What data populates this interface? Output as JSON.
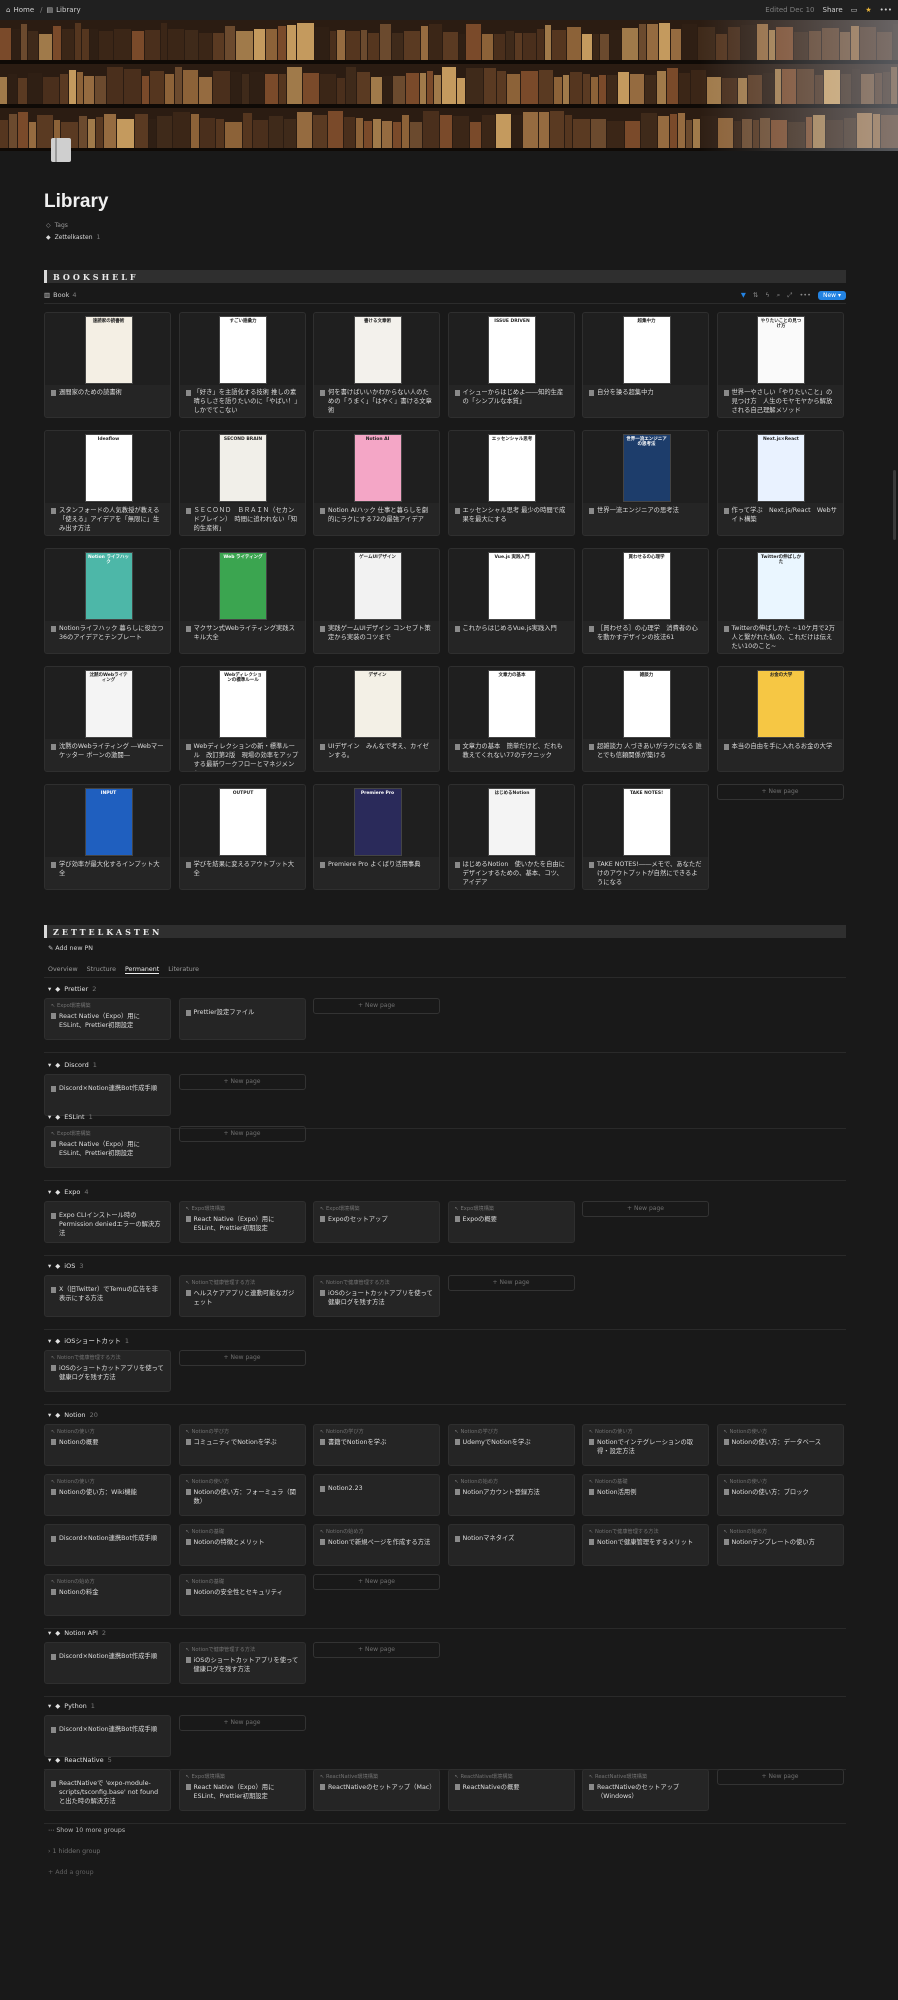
{
  "topbar": {
    "home": "Home",
    "sep": "/",
    "library": "Library",
    "edited": "Edited Dec 10",
    "share": "Share"
  },
  "page": {
    "title": "Library",
    "prop_tags": "Tags",
    "prop_zk": "Zettelkasten",
    "prop_zk_count": "1"
  },
  "bookshelf": {
    "heading": "BOOKSHELF",
    "view": "Book",
    "view_count": "4",
    "new_label": "New"
  },
  "books": [
    {
      "title": "週間家のための読書術",
      "cover": "速読家の読書術",
      "color": "#f4efe4"
    },
    {
      "title": "「好き」を主語化する技術 推しの素晴らしさを語りたいのに「やばい！」しかでてこない",
      "cover": "すごい語彙力",
      "color": "#ffffff"
    },
    {
      "title": "何を書けばいいかわからない人のための「うまく」「はやく」書ける文章術",
      "cover": "書ける文章術",
      "color": "#f3f1ec"
    },
    {
      "title": "イシューからはじめよ――知的生産の「シンプルな本質」",
      "cover": "ISSUE DRIVEN",
      "color": "#ffffff"
    },
    {
      "title": "自分を操る超集中力",
      "cover": "超集中力",
      "color": "#ffffff"
    },
    {
      "title": "世界一やさしい「やりたいこと」の見つけ方　人生のモヤモヤから解放される自己理解メソッド",
      "cover": "やりたいことの見つけ方",
      "color": "#fafafa"
    },
    {
      "title": "スタンフォードの人気教授が教える「使える」アイデアを「無限に」生み出す方法",
      "cover": "Ideaflow",
      "color": "#ffffff"
    },
    {
      "title": "ＳＥＣＯＮＤ　ＢＲＡＩＮ（セカンドブレイン）　時間に追われない「知的生産術」",
      "cover": "SECOND BRAIN",
      "color": "#f1efe9"
    },
    {
      "title": "Notion AIハック 仕事と暮らしを劇的にラクにする72の最強アイデア",
      "cover": "Notion AI",
      "color": "#f4a6c6"
    },
    {
      "title": "エッセンシャル思考 最少の時間で成果を最大にする",
      "cover": "エッセンシャル思考",
      "color": "#ffffff"
    },
    {
      "title": "世界一流エンジニアの思考法",
      "cover": "世界一流エンジニアの思考法",
      "color": "#1d3d6b"
    },
    {
      "title": "作って学ぶ　Next.js/React　Webサイト構築",
      "cover": "Next.js×React",
      "color": "#e9f2ff"
    },
    {
      "title": "Notionライフハック 暮らしに役立つ36のアイデアとテンプレート",
      "cover": "Notion ライフハック",
      "color": "#4db7a8"
    },
    {
      "title": "マクサン式Webライティング実践スキル大全",
      "cover": "Web ライティング",
      "color": "#3ba550"
    },
    {
      "title": "実践ゲームUIデザイン コンセプト策定から実装のコツまで",
      "cover": "ゲームUIデザイン",
      "color": "#f2f2f2"
    },
    {
      "title": "これからはじめるVue.js実践入門",
      "cover": "Vue.js 実践入門",
      "color": "#ffffff"
    },
    {
      "title": "［買わせる］の心理学　消費者の心を動かすデザインの技法61",
      "cover": "買わせるの心理学",
      "color": "#ffffff"
    },
    {
      "title": "Twitterの伸ばしかた ~10ケ月で2万人と繋がれた私の、これだけは伝えたい10のこと~",
      "cover": "Twitterの伸ばしかた",
      "color": "#eaf6ff"
    },
    {
      "title": "沈黙のWebライティング ―Webマーケッター ボーンの激闘―",
      "cover": "沈黙のWebライティング",
      "color": "#f4f4f4"
    },
    {
      "title": "Webディレクションの新・標準ルール　改訂第2版　現場の効率をアップする最新ワークフローとマネジメント",
      "cover": "Webディレクションの標準ルール",
      "color": "#ffffff"
    },
    {
      "title": "UIデザイン　みんなで考え、カイゼンする。",
      "cover": "デザイン",
      "color": "#f3f0e6"
    },
    {
      "title": "文章力の基本　簡単だけど、だれも教えてくれない77のテクニック",
      "cover": "文章力の基本",
      "color": "#ffffff"
    },
    {
      "title": "超雑談力 人づきあいがラクになる 誰とでも信頼関係が築ける",
      "cover": "雑談力",
      "color": "#ffffff"
    },
    {
      "title": "本当の自由を手に入れるお金の大学",
      "cover": "お金の大学",
      "color": "#f6c744"
    },
    {
      "title": "学び効率が最大化するインプット大全",
      "cover": "INPUT",
      "color": "#1f5fbf"
    },
    {
      "title": "学びを結果に変えるアウトプット大全",
      "cover": "OUTPUT",
      "color": "#ffffff"
    },
    {
      "title": "Premiere Pro よくばり活用事典",
      "cover": "Premiere Pro",
      "color": "#2a2a5a"
    },
    {
      "title": "はじめるNotion　使いかたを自由にデザインするための、基本、コツ、アイデア",
      "cover": "はじめるNotion",
      "color": "#f4f4f4"
    },
    {
      "title": "TAKE NOTES!――メモで、あなただけのアウトプットが自然にできるようになる",
      "cover": "TAKE NOTES!",
      "color": "#ffffff"
    }
  ],
  "bookshelf_new": "+ New page",
  "zettelkasten": {
    "heading": "ZETTELKASTEN",
    "add": "Add new PN",
    "tabs": [
      "Overview",
      "Structure",
      "Permanent",
      "Literature"
    ],
    "active_tab": "Permanent",
    "new_page": "+ New page",
    "groups": [
      {
        "name": "Prettier",
        "count": "2",
        "cards": [
          {
            "rel": "Expo環境構築",
            "title": "React Native（Expo）用にESLint、Prettier初期設定"
          },
          {
            "rel": "",
            "title": "Prettier設定ファイル"
          }
        ]
      },
      {
        "name": "Discord",
        "count": "1",
        "cards": [
          {
            "rel": "",
            "title": "Discord×Notion連携Bot作成手順"
          }
        ]
      },
      {
        "name": "ESLint",
        "count": "1",
        "cards": [
          {
            "rel": "Expo環境構築",
            "title": "React Native（Expo）用にESLint、Prettier初期設定"
          }
        ]
      },
      {
        "name": "Expo",
        "count": "4",
        "cards": [
          {
            "rel": "",
            "title": "Expo CLIインストール時のPermission deniedエラーの解決方法"
          },
          {
            "rel": "Expo環境構築",
            "title": "React Native（Expo）用にESLint、Prettier初期設定"
          },
          {
            "rel": "Expo環境構築",
            "title": "Expoのセットアップ"
          },
          {
            "rel": "Expo環境構築",
            "title": "Expoの概要"
          }
        ]
      },
      {
        "name": "iOS",
        "count": "3",
        "cards": [
          {
            "rel": "",
            "title": "X（旧Twitter）でTemuの広告を非表示にする方法"
          },
          {
            "rel": "Notionで健康管理する方法",
            "title": "ヘルスケアアプリと連動可能なガジェット"
          },
          {
            "rel": "Notionで健康管理する方法",
            "title": "iOSのショートカットアプリを使って健康ログを残す方法"
          }
        ]
      },
      {
        "name": "iOSショートカット",
        "count": "1",
        "cards": [
          {
            "rel": "Notionで健康管理する方法",
            "title": "iOSのショートカットアプリを使って健康ログを残す方法"
          }
        ]
      },
      {
        "name": "Notion",
        "count": "20",
        "cards": [
          {
            "rel": "Notionの使い方",
            "title": "Notionの概要"
          },
          {
            "rel": "Notionの学び方",
            "title": "コミュニティでNotionを学ぶ"
          },
          {
            "rel": "Notionの学び方",
            "title": "書籍でNotionを学ぶ"
          },
          {
            "rel": "Notionの学び方",
            "title": "UdemyでNotionを学ぶ"
          },
          {
            "rel": "Notionの使い方",
            "title": "Notionでインテグレーションの取得・設定方法"
          },
          {
            "rel": "Notionの使い方",
            "title": "Notionの使い方：データベース"
          },
          {
            "rel": "Notionの使い方",
            "title": "Notionの使い方：Wiki機能"
          },
          {
            "rel": "Notionの使い方",
            "title": "Notionの使い方：フォーミュラ（関数）"
          },
          {
            "rel": "",
            "title": "Notion2.23"
          },
          {
            "rel": "Notionの始め方",
            "title": "Notionアカウント登録方法"
          },
          {
            "rel": "Notionの基礎",
            "title": "Notion活用例"
          },
          {
            "rel": "Notionの使い方",
            "title": "Notionの使い方：ブロック"
          },
          {
            "rel": "",
            "title": "Discord×Notion連携Bot作成手順"
          },
          {
            "rel": "Notionの基礎",
            "title": "Notionの特徴とメリット"
          },
          {
            "rel": "Notionの始め方",
            "title": "Notionで新規ページを作成する方法"
          },
          {
            "rel": "",
            "title": "Notionマネタイズ"
          },
          {
            "rel": "Notionで健康管理する方法",
            "title": "Notionで健康管理をするメリット"
          },
          {
            "rel": "Notionの始め方",
            "title": "Notionテンプレートの使い方"
          },
          {
            "rel": "Notionの始め方",
            "title": "Notionの料金"
          },
          {
            "rel": "Notionの基礎",
            "title": "Notionの安全性とセキュリティ"
          }
        ]
      },
      {
        "name": "Notion API",
        "count": "2",
        "cards": [
          {
            "rel": "",
            "title": "Discord×Notion連携Bot作成手順"
          },
          {
            "rel": "Notionで健康管理する方法",
            "title": "iOSのショートカットアプリを使って健康ログを残す方法"
          }
        ]
      },
      {
        "name": "Python",
        "count": "1",
        "cards": [
          {
            "rel": "",
            "title": "Discord×Notion連携Bot作成手順"
          }
        ]
      },
      {
        "name": "ReactNative",
        "count": "5",
        "cards": [
          {
            "rel": "",
            "title": "ReactNativeで 'expo-module-scripts/tsconfig.base' not found と出た時の解決方法"
          },
          {
            "rel": "Expo環境構築",
            "title": "React Native（Expo）用にESLint、Prettier初期設定"
          },
          {
            "rel": "ReactNative環境構築",
            "title": "ReactNativeのセットアップ（Mac）"
          },
          {
            "rel": "ReactNative環境構築",
            "title": "ReactNativeの概要"
          },
          {
            "rel": "ReactNative環境構築",
            "title": "ReactNativeのセットアップ（Windows）"
          }
        ]
      }
    ],
    "show_more": "Show 10 more groups",
    "hidden": "1 hidden group",
    "add_group": "+ Add a group"
  }
}
